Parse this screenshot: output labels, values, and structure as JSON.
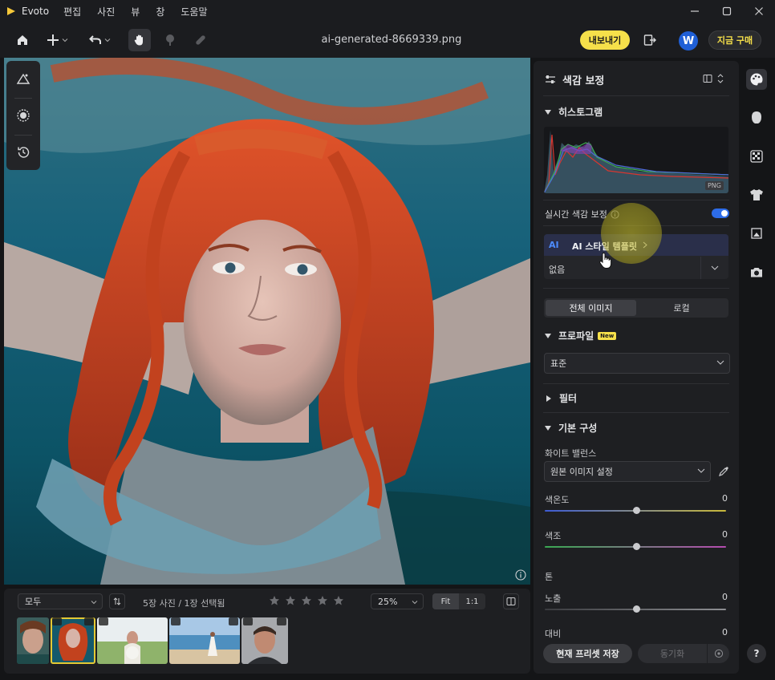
{
  "app": {
    "name": "Evoto",
    "menu": [
      "편집",
      "사진",
      "뷰",
      "창",
      "도움말"
    ]
  },
  "toolbar": {
    "file_name": "ai-generated-8669339.png",
    "export_label": "내보내기",
    "avatar_letter": "W",
    "buy_label": "지금 구매"
  },
  "filmstrip": {
    "filter_value": "모두",
    "count_text": "5장 사진 / 1장 선택됨",
    "zoom_value": "25%",
    "fit_label": "Fit",
    "one_to_one_label": "1:1",
    "rating_stars": 5
  },
  "panel": {
    "title": "색감 보정",
    "histogram": {
      "title": "히스토그램",
      "format_tag": "PNG"
    },
    "realtime_label": "실시간 색감 보정",
    "realtime_on": true,
    "ai_template": {
      "mark": "AI",
      "title": "AI 스타일 템플릿",
      "value": "없음"
    },
    "tabs": [
      "전체 이미지",
      "로컬"
    ],
    "profile": {
      "title": "프로파일",
      "new_badge": "New",
      "value": "표준"
    },
    "filter": {
      "title": "필터"
    },
    "basic": {
      "title": "기본 구성",
      "white_balance_label": "화이트 밸런스",
      "white_balance_value": "원본 이미지 설정",
      "temperature": {
        "label": "색온도",
        "value": "0"
      },
      "tint": {
        "label": "색조",
        "value": "0"
      },
      "tone_label": "톤",
      "exposure": {
        "label": "노출",
        "value": "0"
      },
      "contrast": {
        "label": "대비",
        "value": "0"
      }
    },
    "save_preset_label": "현재 프리셋 저장",
    "sync_label": "동기화"
  },
  "help_label": "?"
}
